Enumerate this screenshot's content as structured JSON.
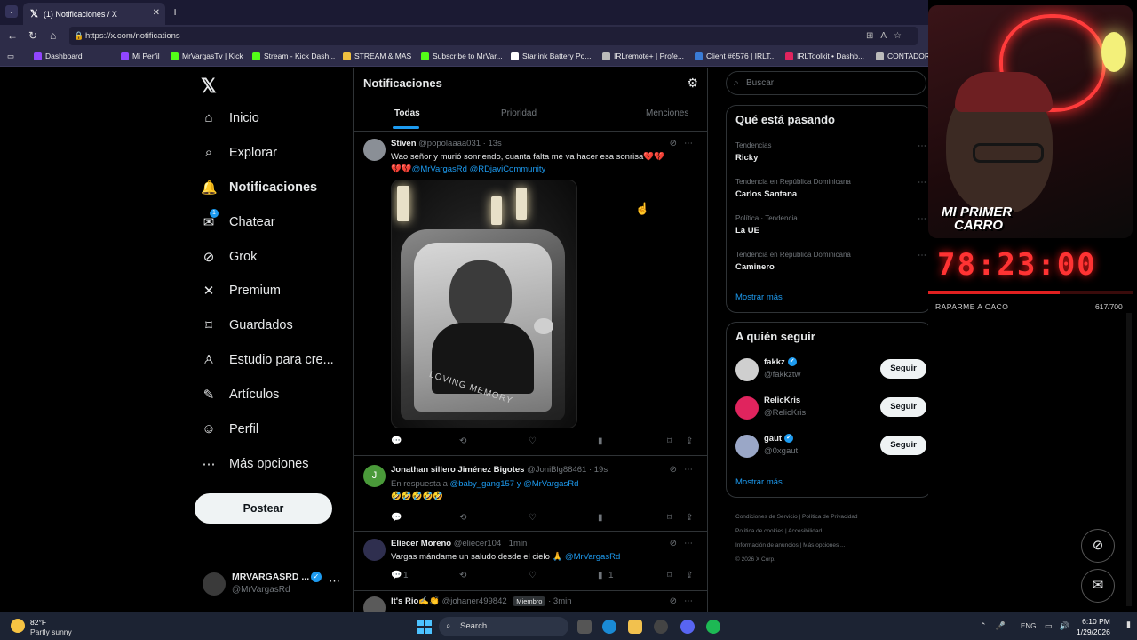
{
  "browser": {
    "tab_title": "(1) Notificaciones / X",
    "url": "https://x.com/notifications",
    "bookmarks": [
      {
        "label": "Dashboard",
        "color": "#9146ff"
      },
      {
        "label": "Mi Perfil",
        "color": "#9146ff"
      },
      {
        "label": "MrVargasTv | Kick",
        "color": "#53fc18"
      },
      {
        "label": "Stream - Kick Dash...",
        "color": "#53fc18"
      },
      {
        "label": "STREAM & MAS",
        "color": "#f0c040"
      },
      {
        "label": "Subscribe to MrVar...",
        "color": "#53fc18"
      },
      {
        "label": "Starlink Battery Po...",
        "color": "#ffffff"
      },
      {
        "label": "IRLremote+ | Profe...",
        "color": "#bbbbbb"
      },
      {
        "label": "Client #6576 | IRLT...",
        "color": "#3a7bd5"
      },
      {
        "label": "IRLToolkit • Dashb...",
        "color": "#e0245e"
      },
      {
        "label": "CONTADOR",
        "color": "#bbbbbb"
      }
    ]
  },
  "nav": {
    "items": [
      {
        "label": "Inicio",
        "icon": "home-icon",
        "glyph": "⌂"
      },
      {
        "label": "Explorar",
        "icon": "search-icon",
        "glyph": "⌕"
      },
      {
        "label": "Notificaciones",
        "icon": "bell-icon",
        "glyph": "🔔"
      },
      {
        "label": "Chatear",
        "icon": "mail-icon",
        "glyph": "✉"
      },
      {
        "label": "Grok",
        "icon": "grok-icon",
        "glyph": "⊘"
      },
      {
        "label": "Premium",
        "icon": "x-icon",
        "glyph": "✕"
      },
      {
        "label": "Guardados",
        "icon": "bookmark-icon",
        "glyph": "⌑"
      },
      {
        "label": "Estudio para cre...",
        "icon": "studio-icon",
        "glyph": "♙"
      },
      {
        "label": "Artículos",
        "icon": "article-icon",
        "glyph": "✎"
      },
      {
        "label": "Perfil",
        "icon": "person-icon",
        "glyph": "☺"
      },
      {
        "label": "Más opciones",
        "icon": "more-icon",
        "glyph": "⋯"
      }
    ],
    "chat_badge": "1",
    "post_label": "Postear",
    "profile": {
      "name": "MRVARGASRD ...",
      "handle": "@MrVargasRd"
    }
  },
  "notifications": {
    "title": "Notificaciones",
    "tabs": [
      "Todas",
      "Prioridad",
      "Menciones"
    ],
    "posts": [
      {
        "name": "Stiven",
        "handle": "@popolaaaa031 · 13s",
        "text": "Wao señor y murió sonriendo, cuanta falta me va hacer esa sonrisa💔💔",
        "line2_prefix": "💔💔",
        "mentions": "@MrVargasRd @RDjaviCommunity",
        "image_caption": "LOVING MEMORY"
      },
      {
        "name": "Jonathan sillero Jiménez Bigotes",
        "handle": "@JoniBlg88461 · 19s",
        "reply_prefix": "En respuesta a",
        "reply_to": "@baby_gang157 y @MrVargasRd",
        "text": "🤣🤣🤣🤣🤣"
      },
      {
        "name": "Eliecer Moreno",
        "handle": "@eliecer104 · 1min",
        "text": "Vargas mándame un saludo desde el cielo 🙏",
        "mention": "@MrVargasRd",
        "replies": "1",
        "views": "1"
      },
      {
        "name": "It's Rio✍️👏",
        "handle": "@johaner499842",
        "badge": "Miembro",
        "time": "· 3min"
      }
    ]
  },
  "sidebar": {
    "search_placeholder": "Buscar",
    "trends_title": "Qué está pasando",
    "trends": [
      {
        "category": "Tendencias",
        "name": "Ricky"
      },
      {
        "category": "Tendencia en República Dominicana",
        "name": "Carlos Santana"
      },
      {
        "category": "Política · Tendencia",
        "name": "La UE"
      },
      {
        "category": "Tendencia en República Dominicana",
        "name": "Caminero"
      }
    ],
    "show_more": "Mostrar más",
    "follow_title": "A quién seguir",
    "follow": [
      {
        "name": "fakkz",
        "handle": "@fakkztw",
        "verified": true,
        "color": "#cfcfcf"
      },
      {
        "name": "RelicKris",
        "handle": "@RelicKris",
        "verified": false,
        "color": "#e0245e"
      },
      {
        "name": "gaut",
        "handle": "@0xgaut",
        "verified": true,
        "color": "#9aa7c7"
      }
    ],
    "follow_button": "Seguir",
    "footer": [
      "Condiciones de Servicio",
      "Política de Privacidad",
      "Política de cookies",
      "Accesibilidad",
      "Información de anuncios",
      "Más opciones ...",
      "© 2026 X Corp."
    ]
  },
  "overlay": {
    "sign_line1": "MI PRIMER",
    "sign_line2": "CARRO",
    "timer": "78:23:00",
    "goal_label": "RAPARME A CACO",
    "goal_count": "617/700",
    "goal_current": 617,
    "goal_target": 700
  },
  "taskbar": {
    "temperature": "82°F",
    "weather": "Partly sunny",
    "search_label": "Search",
    "language": "ENG",
    "time": "6:10 PM",
    "date": "1/29/2026"
  }
}
